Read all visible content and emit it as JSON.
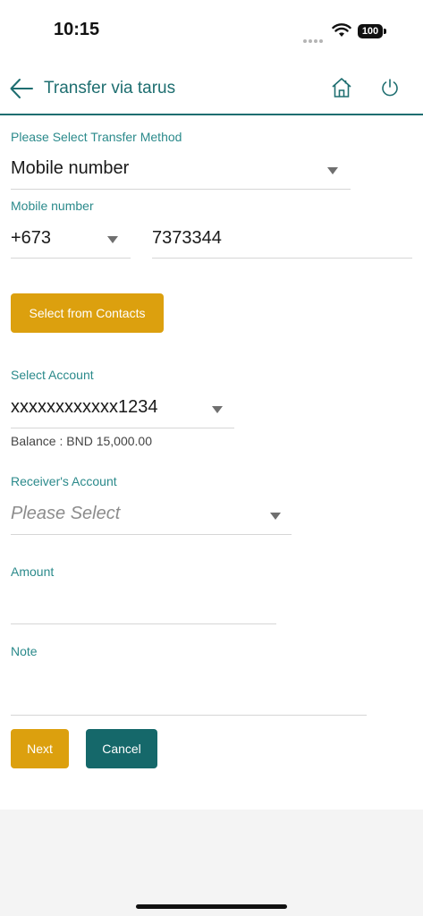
{
  "status_bar": {
    "time": "10:15",
    "battery": "100",
    "icons": [
      "signal-dots-icon",
      "wifi-icon",
      "battery-icon"
    ]
  },
  "header": {
    "title": "Transfer via tarus",
    "icons": [
      "back-arrow-icon",
      "home-icon",
      "power-icon"
    ]
  },
  "transfer_method": {
    "label": "Please Select Transfer Method",
    "value": "Mobile number"
  },
  "mobile_number": {
    "label": "Mobile number",
    "country_code": "+673",
    "number": "7373344"
  },
  "contacts_button": {
    "label": "Select from Contacts"
  },
  "account": {
    "label": "Select Account",
    "value": "xxxxxxxxxxxx1234",
    "balance": "Balance : BND 15,000.00"
  },
  "receiver": {
    "label": "Receiver's Account",
    "placeholder": "Please Select"
  },
  "amount": {
    "label": "Amount",
    "value": ""
  },
  "note": {
    "label": "Note",
    "value": ""
  },
  "actions": {
    "next_label": "Next",
    "cancel_label": "Cancel"
  },
  "colors": {
    "teal": "#1e6e70",
    "label_teal": "#2b8a8b",
    "gold": "#dca00e",
    "cancel_teal": "#15686a"
  }
}
